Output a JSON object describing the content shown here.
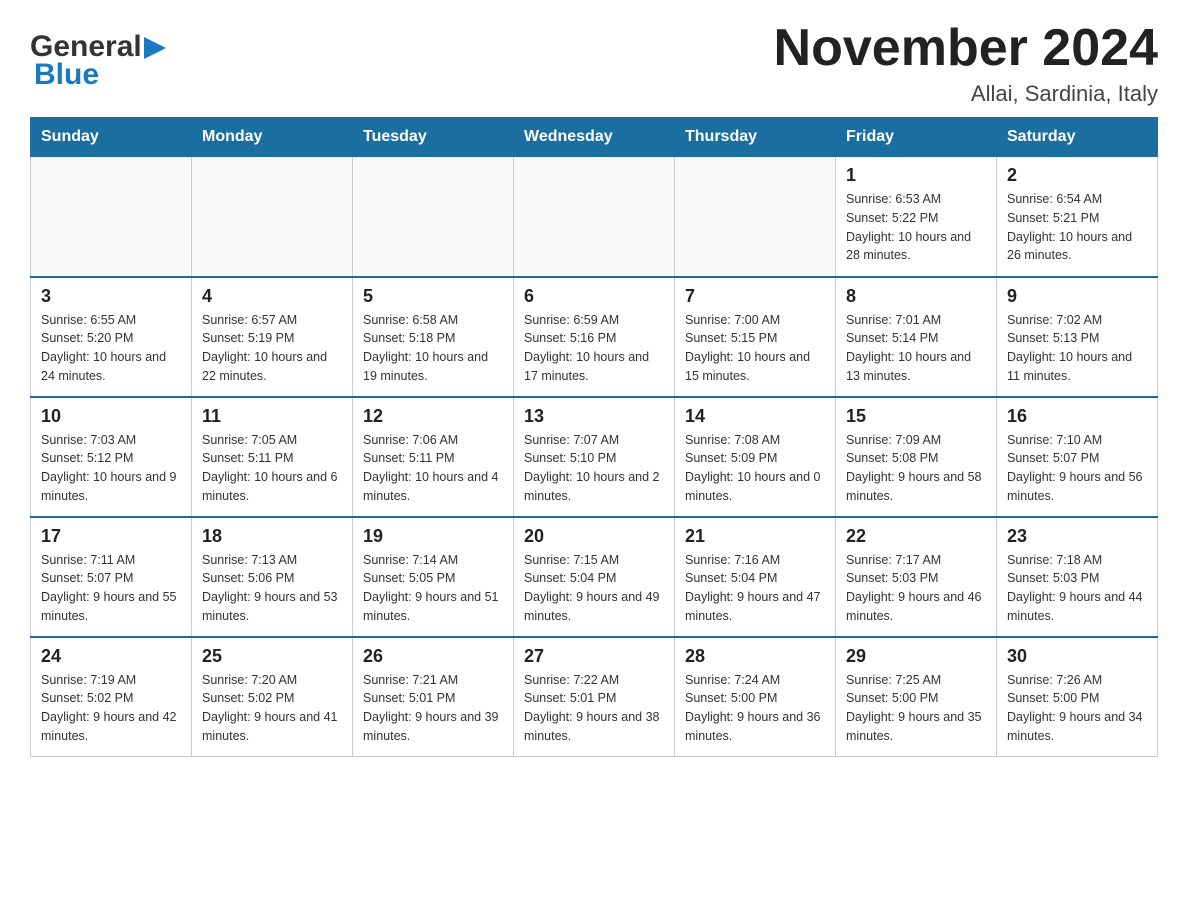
{
  "logo": {
    "general": "General",
    "blue": "Blue"
  },
  "header": {
    "title": "November 2024",
    "location": "Allai, Sardinia, Italy"
  },
  "weekdays": [
    "Sunday",
    "Monday",
    "Tuesday",
    "Wednesday",
    "Thursday",
    "Friday",
    "Saturday"
  ],
  "weeks": [
    [
      {
        "day": "",
        "sunrise": "",
        "sunset": "",
        "daylight": ""
      },
      {
        "day": "",
        "sunrise": "",
        "sunset": "",
        "daylight": ""
      },
      {
        "day": "",
        "sunrise": "",
        "sunset": "",
        "daylight": ""
      },
      {
        "day": "",
        "sunrise": "",
        "sunset": "",
        "daylight": ""
      },
      {
        "day": "",
        "sunrise": "",
        "sunset": "",
        "daylight": ""
      },
      {
        "day": "1",
        "sunrise": "Sunrise: 6:53 AM",
        "sunset": "Sunset: 5:22 PM",
        "daylight": "Daylight: 10 hours and 28 minutes."
      },
      {
        "day": "2",
        "sunrise": "Sunrise: 6:54 AM",
        "sunset": "Sunset: 5:21 PM",
        "daylight": "Daylight: 10 hours and 26 minutes."
      }
    ],
    [
      {
        "day": "3",
        "sunrise": "Sunrise: 6:55 AM",
        "sunset": "Sunset: 5:20 PM",
        "daylight": "Daylight: 10 hours and 24 minutes."
      },
      {
        "day": "4",
        "sunrise": "Sunrise: 6:57 AM",
        "sunset": "Sunset: 5:19 PM",
        "daylight": "Daylight: 10 hours and 22 minutes."
      },
      {
        "day": "5",
        "sunrise": "Sunrise: 6:58 AM",
        "sunset": "Sunset: 5:18 PM",
        "daylight": "Daylight: 10 hours and 19 minutes."
      },
      {
        "day": "6",
        "sunrise": "Sunrise: 6:59 AM",
        "sunset": "Sunset: 5:16 PM",
        "daylight": "Daylight: 10 hours and 17 minutes."
      },
      {
        "day": "7",
        "sunrise": "Sunrise: 7:00 AM",
        "sunset": "Sunset: 5:15 PM",
        "daylight": "Daylight: 10 hours and 15 minutes."
      },
      {
        "day": "8",
        "sunrise": "Sunrise: 7:01 AM",
        "sunset": "Sunset: 5:14 PM",
        "daylight": "Daylight: 10 hours and 13 minutes."
      },
      {
        "day": "9",
        "sunrise": "Sunrise: 7:02 AM",
        "sunset": "Sunset: 5:13 PM",
        "daylight": "Daylight: 10 hours and 11 minutes."
      }
    ],
    [
      {
        "day": "10",
        "sunrise": "Sunrise: 7:03 AM",
        "sunset": "Sunset: 5:12 PM",
        "daylight": "Daylight: 10 hours and 9 minutes."
      },
      {
        "day": "11",
        "sunrise": "Sunrise: 7:05 AM",
        "sunset": "Sunset: 5:11 PM",
        "daylight": "Daylight: 10 hours and 6 minutes."
      },
      {
        "day": "12",
        "sunrise": "Sunrise: 7:06 AM",
        "sunset": "Sunset: 5:11 PM",
        "daylight": "Daylight: 10 hours and 4 minutes."
      },
      {
        "day": "13",
        "sunrise": "Sunrise: 7:07 AM",
        "sunset": "Sunset: 5:10 PM",
        "daylight": "Daylight: 10 hours and 2 minutes."
      },
      {
        "day": "14",
        "sunrise": "Sunrise: 7:08 AM",
        "sunset": "Sunset: 5:09 PM",
        "daylight": "Daylight: 10 hours and 0 minutes."
      },
      {
        "day": "15",
        "sunrise": "Sunrise: 7:09 AM",
        "sunset": "Sunset: 5:08 PM",
        "daylight": "Daylight: 9 hours and 58 minutes."
      },
      {
        "day": "16",
        "sunrise": "Sunrise: 7:10 AM",
        "sunset": "Sunset: 5:07 PM",
        "daylight": "Daylight: 9 hours and 56 minutes."
      }
    ],
    [
      {
        "day": "17",
        "sunrise": "Sunrise: 7:11 AM",
        "sunset": "Sunset: 5:07 PM",
        "daylight": "Daylight: 9 hours and 55 minutes."
      },
      {
        "day": "18",
        "sunrise": "Sunrise: 7:13 AM",
        "sunset": "Sunset: 5:06 PM",
        "daylight": "Daylight: 9 hours and 53 minutes."
      },
      {
        "day": "19",
        "sunrise": "Sunrise: 7:14 AM",
        "sunset": "Sunset: 5:05 PM",
        "daylight": "Daylight: 9 hours and 51 minutes."
      },
      {
        "day": "20",
        "sunrise": "Sunrise: 7:15 AM",
        "sunset": "Sunset: 5:04 PM",
        "daylight": "Daylight: 9 hours and 49 minutes."
      },
      {
        "day": "21",
        "sunrise": "Sunrise: 7:16 AM",
        "sunset": "Sunset: 5:04 PM",
        "daylight": "Daylight: 9 hours and 47 minutes."
      },
      {
        "day": "22",
        "sunrise": "Sunrise: 7:17 AM",
        "sunset": "Sunset: 5:03 PM",
        "daylight": "Daylight: 9 hours and 46 minutes."
      },
      {
        "day": "23",
        "sunrise": "Sunrise: 7:18 AM",
        "sunset": "Sunset: 5:03 PM",
        "daylight": "Daylight: 9 hours and 44 minutes."
      }
    ],
    [
      {
        "day": "24",
        "sunrise": "Sunrise: 7:19 AM",
        "sunset": "Sunset: 5:02 PM",
        "daylight": "Daylight: 9 hours and 42 minutes."
      },
      {
        "day": "25",
        "sunrise": "Sunrise: 7:20 AM",
        "sunset": "Sunset: 5:02 PM",
        "daylight": "Daylight: 9 hours and 41 minutes."
      },
      {
        "day": "26",
        "sunrise": "Sunrise: 7:21 AM",
        "sunset": "Sunset: 5:01 PM",
        "daylight": "Daylight: 9 hours and 39 minutes."
      },
      {
        "day": "27",
        "sunrise": "Sunrise: 7:22 AM",
        "sunset": "Sunset: 5:01 PM",
        "daylight": "Daylight: 9 hours and 38 minutes."
      },
      {
        "day": "28",
        "sunrise": "Sunrise: 7:24 AM",
        "sunset": "Sunset: 5:00 PM",
        "daylight": "Daylight: 9 hours and 36 minutes."
      },
      {
        "day": "29",
        "sunrise": "Sunrise: 7:25 AM",
        "sunset": "Sunset: 5:00 PM",
        "daylight": "Daylight: 9 hours and 35 minutes."
      },
      {
        "day": "30",
        "sunrise": "Sunrise: 7:26 AM",
        "sunset": "Sunset: 5:00 PM",
        "daylight": "Daylight: 9 hours and 34 minutes."
      }
    ]
  ]
}
